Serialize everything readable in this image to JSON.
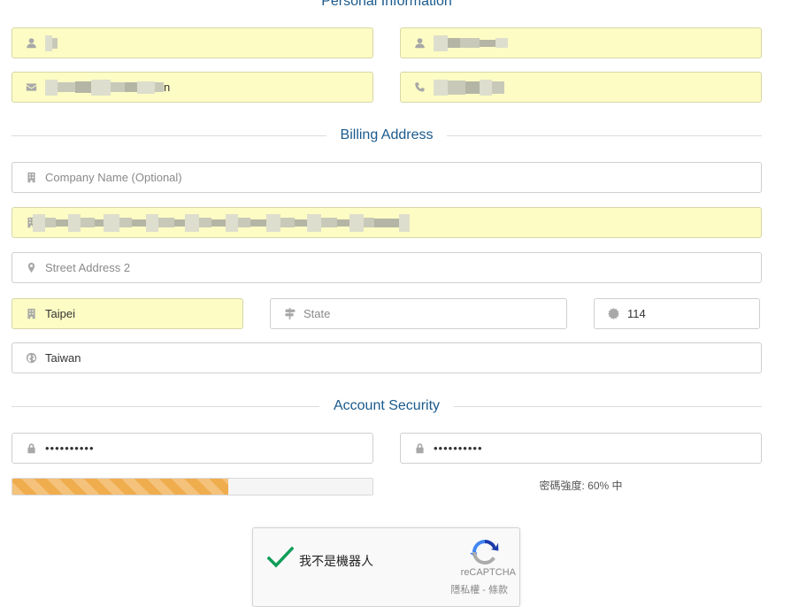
{
  "sections": {
    "personal": "Personal Information",
    "billing": "Billing Address",
    "security": "Account Security"
  },
  "billing": {
    "company_placeholder": "Company Name (Optional)",
    "address2_placeholder": "Street Address 2",
    "city_value": "Taipei",
    "state_placeholder": "State",
    "postcode_value": "114",
    "country_value": "Taiwan"
  },
  "personal": {
    "email_suffix": "n"
  },
  "security": {
    "password_value": "••••••••••",
    "confirm_value": "••••••••••",
    "strength_label": "密碼強度: 60% 中",
    "strength_percent": 60
  },
  "captcha": {
    "label": "我不是機器人",
    "brand": "reCAPTCHA",
    "links": "隱私權 - 條款"
  },
  "colors": {
    "accent": "#1a5a8c",
    "autofill": "#fcfcc4",
    "strength": "#f0ad4e",
    "check": "#0f9d58"
  }
}
